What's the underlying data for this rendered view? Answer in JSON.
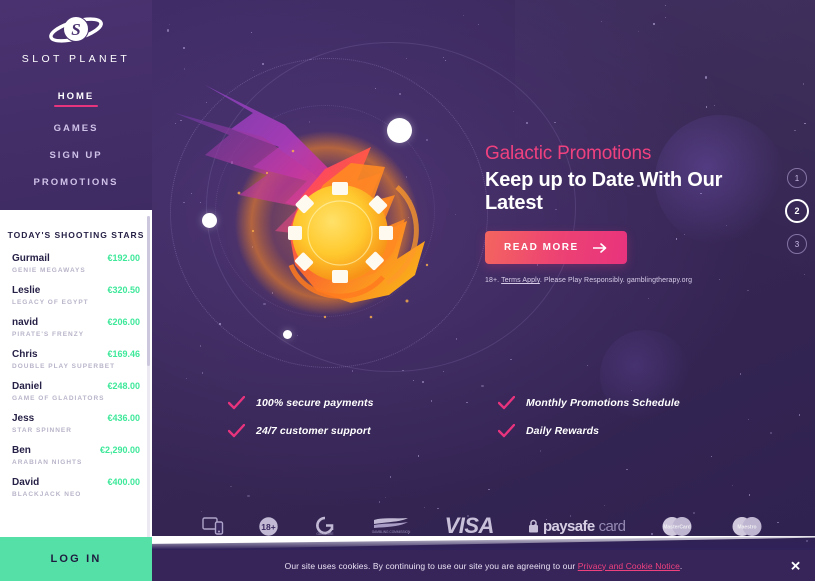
{
  "brand": {
    "name": "SLOT PLANET",
    "logo_icon": "planet-ring-icon"
  },
  "nav": {
    "items": [
      {
        "label": "HOME",
        "active": true
      },
      {
        "label": "GAMES",
        "active": false
      },
      {
        "label": "SIGN UP",
        "active": false
      },
      {
        "label": "PROMOTIONS",
        "active": false
      }
    ]
  },
  "sidebar": {
    "panel_title": "TODAY'S SHOOTING STARS",
    "login_label": "LOG IN",
    "winners": [
      {
        "name": "Gurmail",
        "amount": "€192.00",
        "game": "GENIE MEGAWAYS"
      },
      {
        "name": "Leslie",
        "amount": "€320.50",
        "game": "LEGACY OF EGYPT"
      },
      {
        "name": "navid",
        "amount": "€206.00",
        "game": "PIRATE'S FRENZY"
      },
      {
        "name": "Chris",
        "amount": "€169.46",
        "game": "DOUBLE PLAY SUPERBET"
      },
      {
        "name": "Daniel",
        "amount": "€248.00",
        "game": "GAME OF GLADIATORS"
      },
      {
        "name": "Jess",
        "amount": "€436.00",
        "game": "STAR SPINNER"
      },
      {
        "name": "Ben",
        "amount": "€2,290.00",
        "game": "ARABIAN NIGHTS"
      },
      {
        "name": "David",
        "amount": "€400.00",
        "game": "BLACKJACK NEO"
      }
    ]
  },
  "hero": {
    "eyebrow": "Galactic Promotions",
    "title": "Keep up to Date With Our Latest",
    "cta_label": "READ MORE",
    "cta_icon": "arrow-right-icon",
    "legal_prefix": "18+. ",
    "legal_link": "Terms Apply",
    "legal_suffix": ". Please Play Responsibly. gamblingtherapy.org"
  },
  "carousel": {
    "slides": [
      {
        "label": "1",
        "active": false
      },
      {
        "label": "2",
        "active": true
      },
      {
        "label": "3",
        "active": false
      }
    ]
  },
  "features": [
    {
      "label": "100% secure payments",
      "icon": "check-icon"
    },
    {
      "label": "Monthly Promotions Schedule",
      "icon": "check-icon"
    },
    {
      "label": "24/7 customer support",
      "icon": "check-icon"
    },
    {
      "label": "Daily Rewards",
      "icon": "check-icon"
    }
  ],
  "payment_logos": [
    {
      "name": "responsive-devices-icon",
      "text": ""
    },
    {
      "name": "eighteen-plus-icon",
      "text": "18+"
    },
    {
      "name": "gamcare-icon",
      "text": "GamCare"
    },
    {
      "name": "gambling-commission-icon",
      "text": "GAMBLING COMMISSION"
    },
    {
      "name": "visa-icon",
      "text": "VISA"
    },
    {
      "name": "paysafecard-icon",
      "text": "paysafecard"
    },
    {
      "name": "mastercard-icon",
      "text": "MasterCard"
    },
    {
      "name": "maestro-icon",
      "text": "Maestro"
    }
  ],
  "cookie": {
    "text_prefix": "Our site uses cookies. By continuing to use our site you are agreeing to our ",
    "link": "Privacy and Cookie Notice",
    "text_suffix": ".",
    "close_label": "✕"
  },
  "colors": {
    "accent_pink": "#e8337d",
    "accent_coral": "#f4655f",
    "mint": "#55e0a8",
    "win_green": "#3ee89a",
    "bg_purple": "#3a2a60",
    "nav_purple": "#3f2b63",
    "cookie_bar": "#372459"
  }
}
